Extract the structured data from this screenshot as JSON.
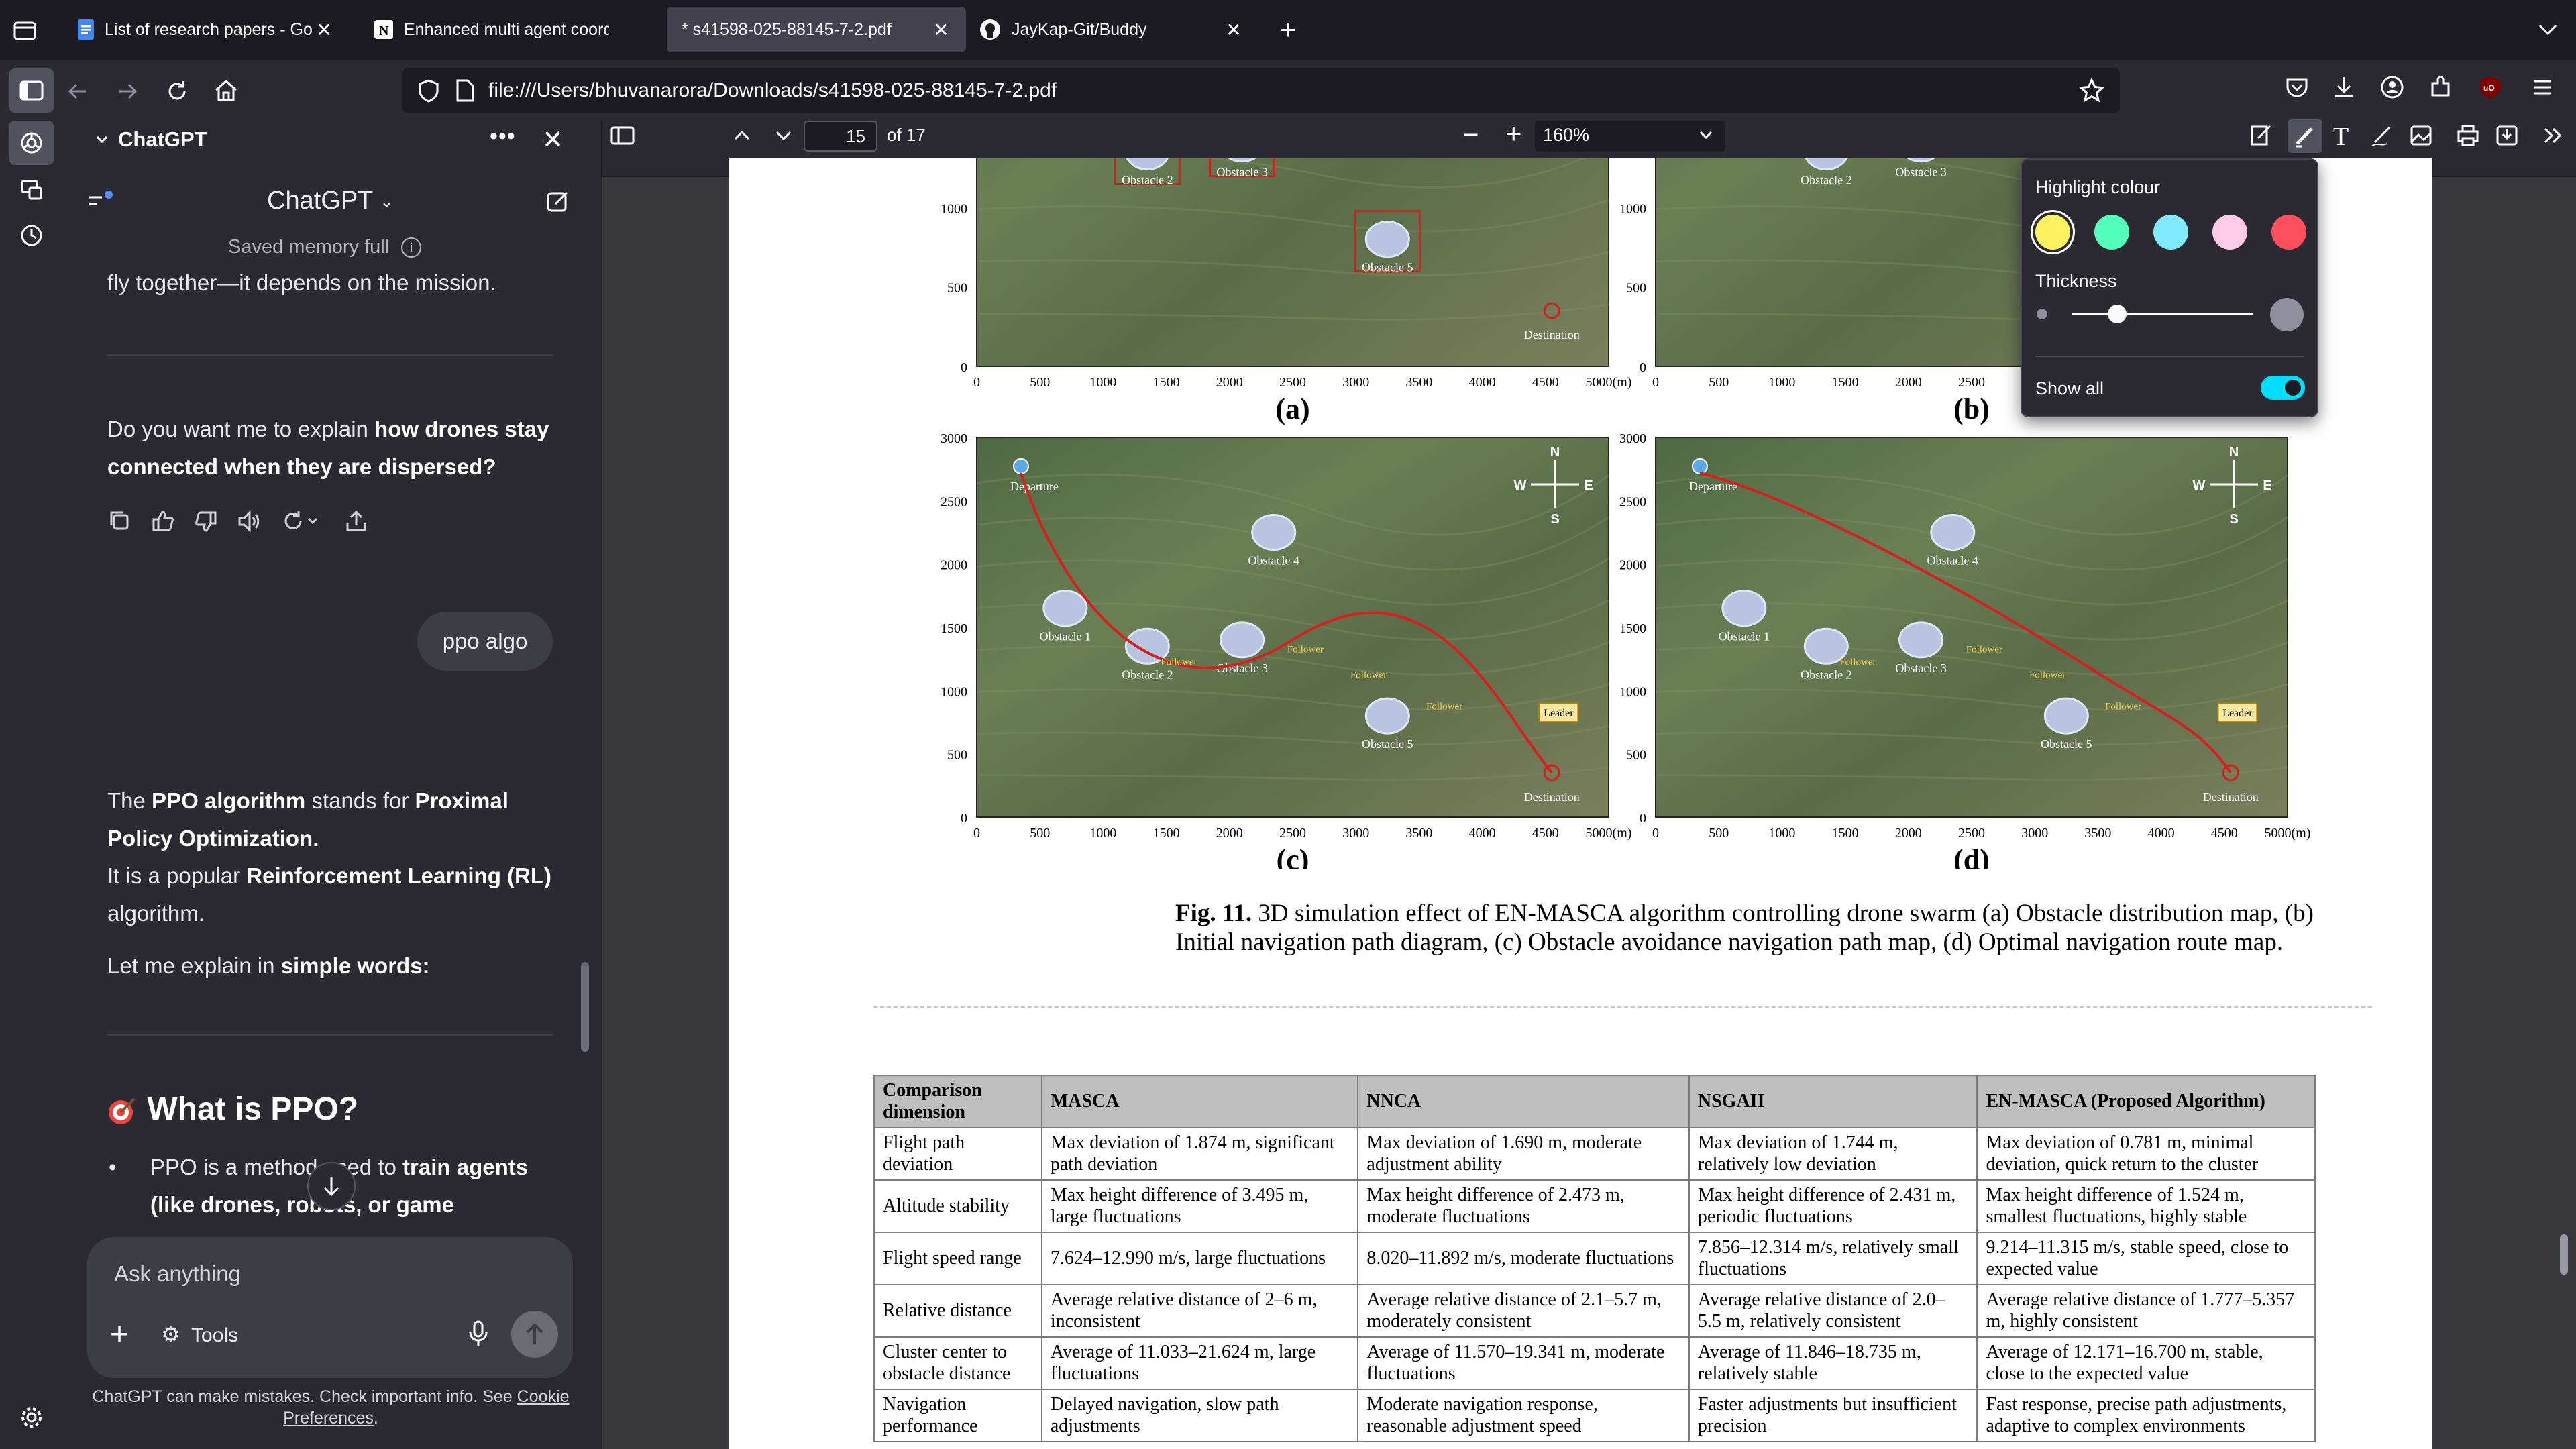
{
  "tabs": [
    {
      "label": "List of research papers - Googl",
      "icon": "google-docs-icon"
    },
    {
      "label": "Enhanced multi agent coordinat",
      "icon": "notion-icon"
    },
    {
      "label": "* s41598-025-88145-7-2.pdf",
      "icon": "pdf-icon"
    },
    {
      "label": "JayKap-Git/Buddy",
      "icon": "github-icon"
    }
  ],
  "address": {
    "url": "file:///Users/bhuvanarora/Downloads/s41598-025-88145-7-2.pdf"
  },
  "sidebar": {
    "title": "ChatGPT",
    "model": "ChatGPT",
    "memory": "Saved memory full",
    "prev_tail": "fly together—it depends on the mission.",
    "question_pre": "Do you want me to explain ",
    "question_bold": "how drones stay connected when they are dispersed?",
    "user_msg": "ppo algo",
    "p1_a": "The ",
    "p1_b": "PPO algorithm",
    "p1_c": " stands for ",
    "p1_d": "Proximal Policy Optimization.",
    "p2_a": "It is a popular ",
    "p2_b": "Reinforcement Learning (RL)",
    "p2_c": " algorithm.",
    "p3_a": "Let me explain in ",
    "p3_b": "simple words:",
    "heading": "What is PPO?",
    "bullet_a": "PPO is a method ",
    "bullet_b": "used to ",
    "bullet_c": "train agents",
    "bullet_d": "(like drones, robots, or game",
    "input_placeholder": "Ask anything",
    "tools_label": "Tools",
    "disclaimer": "ChatGPT can make mistakes. Check important info. See ",
    "cookie_link": "Cookie Preferences",
    "disclaimer_end": "."
  },
  "pdf": {
    "page_current": "15",
    "page_total": "of 17",
    "zoom": "160%",
    "caption_bold": "Fig. 11.",
    "caption_text": " 3D simulation effect of EN-MASCA algorithm controlling drone swarm (a) Obstacle distribution map, (b) Initial navigation path diagram, (c) Obstacle avoidance navigation path map, (d) Optimal navigation route map.",
    "subfigures": [
      "(a)",
      "(b)",
      "(c)",
      "(d)"
    ],
    "y_ticks": [
      "3000",
      "2500",
      "2000",
      "1500",
      "1000",
      "500",
      "0"
    ],
    "x_ticks": [
      "0",
      "500",
      "1000",
      "1500",
      "2000",
      "2500",
      "3000",
      "3500",
      "4000",
      "4500",
      "5000(m)"
    ],
    "map_labels": {
      "obstacle1": "Obstacle 1",
      "obstacle2": "Obstacle 2",
      "obstacle3": "Obstacle 3",
      "obstacle4": "Obstacle 4",
      "obstacle5": "Obstacle 5",
      "departure": "Departure",
      "destination": "Destination",
      "leader": "Leader",
      "follower": "Follower",
      "compass_n": "N",
      "compass_s": "S",
      "compass_e": "E",
      "compass_w": "W"
    },
    "table": {
      "headers": [
        "Comparison dimension",
        "MASCA",
        "NNCA",
        "NSGAII",
        "EN-MASCA (Proposed Algorithm)"
      ],
      "rows": [
        [
          "Flight path deviation",
          "Max deviation of 1.874 m, significant path deviation",
          "Max deviation of 1.690 m, moderate adjustment ability",
          "Max deviation of 1.744 m, relatively low deviation",
          "Max deviation of 0.781 m, minimal deviation, quick return to the cluster"
        ],
        [
          "Altitude stability",
          "Max height difference of 3.495 m, large fluctuations",
          "Max height difference of 2.473 m, moderate fluctuations",
          "Max height difference of 2.431 m, periodic fluctuations",
          "Max height difference of 1.524 m, smallest fluctuations, highly stable"
        ],
        [
          "Flight speed range",
          "7.624–12.990 m/s, large fluctuations",
          "8.020–11.892 m/s, moderate fluctuations",
          "7.856–12.314 m/s, relatively small fluctuations",
          "9.214–11.315 m/s, stable speed, close to expected value"
        ],
        [
          "Relative distance",
          "Average relative distance of 2–6 m, inconsistent",
          "Average relative distance of 2.1–5.7 m, moderately consistent",
          "Average relative distance of 2.0–5.5 m, relatively consistent",
          "Average relative distance of 1.777–5.357 m, highly consistent"
        ],
        [
          "Cluster center to obstacle distance",
          "Average of 11.033–21.624 m, large fluctuations",
          "Average of 11.570–19.341 m, moderate fluctuations",
          "Average of 11.846–18.735 m, relatively stable",
          "Average of 12.171–16.700 m, stable, close to the expected value"
        ],
        [
          "Navigation performance",
          "Delayed navigation, slow path adjustments",
          "Moderate navigation response, reasonable adjustment speed",
          "Faster adjustments but insufficient precision",
          "Fast response, precise path adjustments, adaptive to complex environments"
        ]
      ]
    }
  },
  "highlight_popup": {
    "title": "Highlight colour",
    "colors": [
      "#fff160",
      "#54ffbd",
      "#80ebff",
      "#ffcbe6",
      "#ff4f5e"
    ],
    "thickness_label": "Thickness",
    "thickness_value": 0.25,
    "show_all_label": "Show all",
    "show_all_on": true,
    "accent": "#00ddff"
  }
}
